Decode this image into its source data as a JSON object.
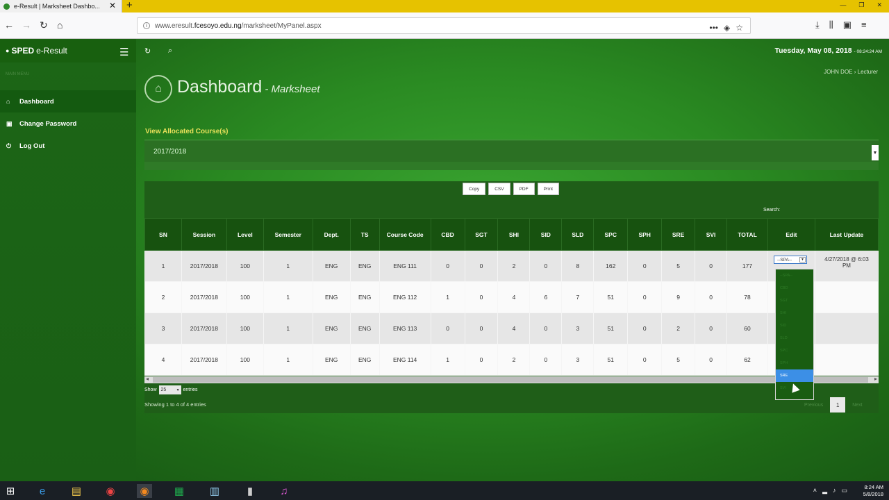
{
  "browser": {
    "tab_title": "e-Result | Marksheet Dashbo...",
    "tab_close": "✕",
    "new_tab": "+",
    "url_prefix": "www.eresult.",
    "url_domain": "fcesoyo.edu.ng",
    "url_path": "/marksheet/MyPanel.aspx",
    "url_menu": "•••"
  },
  "app": {
    "brand_prefix": "SPED",
    "brand_suffix": "e-Result",
    "nav_header": "MAIN MENU",
    "nav": [
      {
        "label": "Dashboard"
      },
      {
        "label": "Change Password"
      },
      {
        "label": "Log Out"
      }
    ],
    "date": "Tuesday, May 08, 2018",
    "time": "- 08:24:24 AM",
    "breadcrumb_user": "JOHN DOE",
    "breadcrumb_role": "Lecturer",
    "page_title": "Dashboard",
    "page_subtitle": "- Marksheet",
    "courses_label": "View Allocated Course(s)",
    "session_value": "2017/2018"
  },
  "table": {
    "export_buttons": [
      "Copy",
      "CSV",
      "PDF",
      "Print"
    ],
    "search_label": "Search:",
    "columns": [
      "SN",
      "Session",
      "Level",
      "Semester",
      "Dept.",
      "TS",
      "Course Code",
      "CBD",
      "SGT",
      "SHI",
      "SID",
      "SLD",
      "SPC",
      "SPH",
      "SRE",
      "SVI",
      "TOTAL",
      "Edit",
      "Last Update"
    ],
    "rows": [
      [
        "1",
        "2017/2018",
        "100",
        "1",
        "ENG",
        "ENG",
        "ENG 111",
        "0",
        "0",
        "2",
        "0",
        "8",
        "162",
        "0",
        "5",
        "0",
        "177"
      ],
      [
        "2",
        "2017/2018",
        "100",
        "1",
        "ENG",
        "ENG",
        "ENG 112",
        "1",
        "0",
        "4",
        "6",
        "7",
        "51",
        "0",
        "9",
        "0",
        "78"
      ],
      [
        "3",
        "2017/2018",
        "100",
        "1",
        "ENG",
        "ENG",
        "ENG 113",
        "0",
        "0",
        "4",
        "0",
        "3",
        "51",
        "0",
        "2",
        "0",
        "60"
      ],
      [
        "4",
        "2017/2018",
        "100",
        "1",
        "ENG",
        "ENG",
        "ENG 114",
        "1",
        "0",
        "2",
        "0",
        "3",
        "51",
        "0",
        "5",
        "0",
        "62"
      ]
    ],
    "edit_select_value": "--SPA--",
    "last_update_row1": "4/27/2018 @ 6:03 PM",
    "dropdown_options": [
      "--SPA--",
      "CBD",
      "SGT",
      "SHI",
      "SID",
      "SLD",
      "SPC",
      "SPH",
      "SRE",
      "SVI"
    ],
    "dropdown_highlight": "SRE",
    "show_label": "Show",
    "entries_value": "25",
    "entries_label": "entries",
    "info": "Showing 1 to 4 of 4 entries",
    "pager_prev": "Previous",
    "pager_page": "1",
    "pager_next": "Next"
  },
  "taskbar": {
    "time": "8:24 AM",
    "date": "5/8/2018"
  },
  "colors": {
    "accent_green": "#2a8a22",
    "header_green": "#17520f",
    "label_yellow": "#e8e05a",
    "browser_bar": "#e6c200"
  }
}
